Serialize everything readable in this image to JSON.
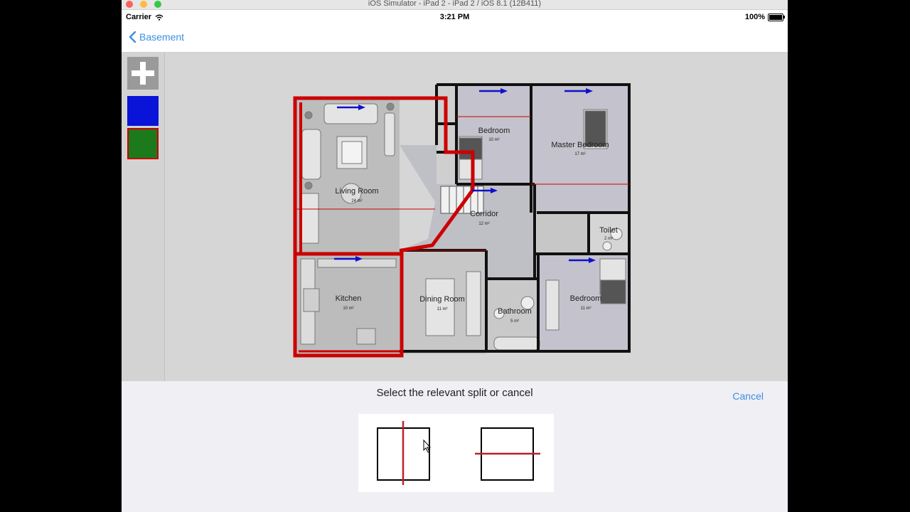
{
  "window": {
    "title": "iOS Simulator - iPad 2 - iPad 2 / iOS 8.1 (12B411)"
  },
  "status_bar": {
    "carrier": "Carrier",
    "time": "3:21 PM",
    "battery": "100%"
  },
  "nav": {
    "back_label": "Basement"
  },
  "toolbar": {
    "add_icon": "plus-icon",
    "swatches": [
      {
        "name": "blue",
        "color": "#0a14d8"
      },
      {
        "name": "green",
        "color": "#1c7a1c",
        "selected": true
      }
    ]
  },
  "floorplan": {
    "rooms": [
      {
        "label": "Living Room",
        "area": "24 m²"
      },
      {
        "label": "Bedroom",
        "area": "10 m²"
      },
      {
        "label": "Master Bedroom",
        "area": "17 m²"
      },
      {
        "label": "Corridor",
        "area": "12 m²"
      },
      {
        "label": "Toilet",
        "area": "2 m²"
      },
      {
        "label": "Kitchen",
        "area": "10 m²"
      },
      {
        "label": "Dining Room",
        "area": "11 m²"
      },
      {
        "label": "Bathroom",
        "area": "5 m²"
      },
      {
        "label": "Bedroom",
        "area": "11 m²"
      }
    ],
    "highlight_color": "#cc0000",
    "arrow_color": "#1010cc"
  },
  "split_sheet": {
    "prompt": "Select the relevant split or cancel",
    "cancel_label": "Cancel",
    "options": [
      {
        "name": "vertical-split"
      },
      {
        "name": "horizontal-split"
      }
    ],
    "split_line_color": "#c0202a"
  }
}
